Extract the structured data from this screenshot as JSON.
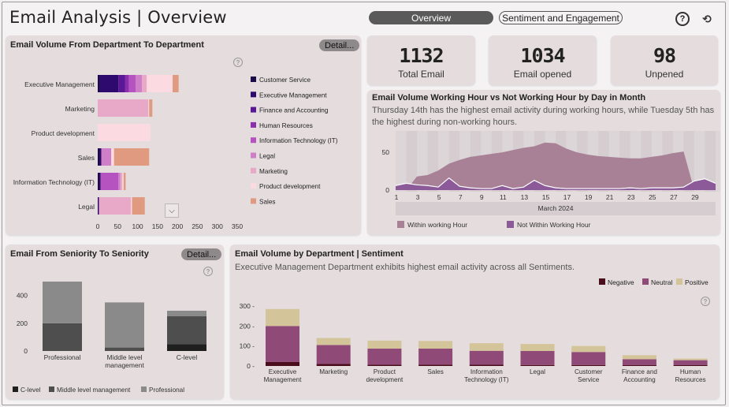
{
  "header": {
    "title": "Email Analysis | Overview",
    "tabs": [
      {
        "label": "Overview",
        "active": true
      },
      {
        "label": "Sentiment and Engagement",
        "active": false
      }
    ],
    "help_icon": "help-icon",
    "reset_icon": "reset-icon"
  },
  "kpis": [
    {
      "value": "1132",
      "label": "Total Email"
    },
    {
      "value": "1034",
      "label": "Email opened"
    },
    {
      "value": "98",
      "label": "Unpened"
    }
  ],
  "dept_card": {
    "title": "Email Volume From Department To Department",
    "detail_label": "Detail..."
  },
  "seniority_card": {
    "title": "Email From Seniority To Seniority",
    "detail_label": "Detail..."
  },
  "hours_card": {
    "title": "Email Volume Working Hour vs Not Working Hour by Day in Month",
    "subtitle": "Thursday 14th has the highest email activity during working hours, while Tuesday 5th has the highest during non-working hours."
  },
  "sentiment_card": {
    "title": "Email Volume by Department | Sentiment",
    "subtitle": "Executive Management Department exhibits highest email activity across all Sentiments."
  },
  "colors": {
    "customer_service": "#1b0b47",
    "executive_management": "#2e0a6e",
    "finance_accounting": "#5a1896",
    "human_resources": "#8c2fad",
    "it": "#b554c0",
    "legal": "#cf7ec8",
    "marketing": "#e8a9c8",
    "product_development": "#fbdbe1",
    "sales": "#df9a80",
    "within": "#a88197",
    "not_within": "#8c5a98",
    "negative": "#4a0d1b",
    "neutral": "#8f4a78",
    "positive": "#d4c49a",
    "c_level": "#1f1f1f",
    "middle": "#4e4e4e",
    "professional": "#8a8a8a"
  },
  "chart_data": [
    {
      "type": "bar",
      "orientation": "horizontal",
      "stacked": true,
      "categories": [
        "Executive Management",
        "Marketing",
        "Product development",
        "Sales",
        "Information Technology (IT)",
        "Legal"
      ],
      "xlim": [
        0,
        350
      ],
      "x_ticks": [
        "0",
        "50",
        "100",
        "150",
        "200",
        "250",
        "300",
        "350"
      ],
      "series": [
        {
          "name": "Customer Service",
          "values": [
            5,
            0,
            0,
            5,
            5,
            0
          ]
        },
        {
          "name": "Executive Management",
          "values": [
            47,
            0,
            0,
            4,
            2,
            3
          ]
        },
        {
          "name": "Finance and Accounting",
          "values": [
            17,
            0,
            0,
            0,
            0,
            0
          ]
        },
        {
          "name": "Human Resources",
          "values": [
            9,
            0,
            0,
            0,
            0,
            0
          ]
        },
        {
          "name": "Information Technology (IT)",
          "values": [
            17,
            0,
            0,
            0,
            45,
            0
          ]
        },
        {
          "name": "Legal",
          "values": [
            16,
            0,
            0,
            25,
            5,
            0
          ]
        },
        {
          "name": "Marketing",
          "values": [
            12,
            127,
            0,
            0,
            5,
            80
          ]
        },
        {
          "name": "Product development",
          "values": [
            65,
            2,
            132,
            7,
            3,
            3
          ]
        },
        {
          "name": "Sales",
          "values": [
            15,
            8,
            0,
            88,
            5,
            32
          ]
        }
      ],
      "legend_position": "right"
    },
    {
      "type": "area",
      "x": [
        "1",
        "2",
        "3",
        "4",
        "5",
        "6",
        "7",
        "8",
        "9",
        "10",
        "11",
        "12",
        "13",
        "14",
        "15",
        "16",
        "17",
        "18",
        "19",
        "20",
        "21",
        "22",
        "23",
        "24",
        "25",
        "26",
        "27",
        "28",
        "29",
        "30",
        "31"
      ],
      "x_ticks": [
        "1",
        "3",
        "5",
        "7",
        "9",
        "11",
        "13",
        "15",
        "17",
        "19",
        "21",
        "23",
        "25",
        "27",
        "29"
      ],
      "xlabel": "March 2024",
      "y_ticks": [
        "0",
        "50"
      ],
      "series": [
        {
          "name": "Within working Hour",
          "values": [
            0,
            0,
            18,
            20,
            26,
            35,
            40,
            44,
            46,
            48,
            50,
            53,
            56,
            58,
            63,
            62,
            55,
            50,
            47,
            45,
            44,
            43,
            42,
            42,
            44,
            46,
            49,
            51,
            0,
            0,
            0
          ]
        },
        {
          "name": "Not Within Working Hour",
          "values": [
            6,
            9,
            7,
            6,
            4,
            16,
            5,
            3,
            2,
            2,
            6,
            2,
            4,
            13,
            6,
            3,
            2,
            2,
            2,
            2,
            2,
            2,
            3,
            2,
            3,
            3,
            3,
            4,
            12,
            15,
            9
          ]
        }
      ],
      "legend_position": "bottom"
    },
    {
      "type": "bar",
      "stacked": true,
      "categories": [
        "Professional",
        "Middle level management",
        "C-level"
      ],
      "y_ticks": [
        "0",
        "200",
        "400"
      ],
      "series": [
        {
          "name": "C-level",
          "values": [
            0,
            0,
            50
          ]
        },
        {
          "name": "Middle level management",
          "values": [
            200,
            25,
            200
          ]
        },
        {
          "name": "Professional",
          "values": [
            300,
            325,
            40
          ]
        }
      ],
      "legend_position": "bottom"
    },
    {
      "type": "bar",
      "stacked": true,
      "categories": [
        "Executive Management",
        "Marketing",
        "Product development",
        "Sales",
        "Information Technology (IT)",
        "Legal",
        "Customer Service",
        "Finance and Accounting",
        "Human Resources"
      ],
      "y_ticks": [
        "0",
        "100",
        "200",
        "300"
      ],
      "series": [
        {
          "name": "Negative",
          "values": [
            20,
            10,
            7,
            7,
            6,
            5,
            5,
            4,
            4
          ]
        },
        {
          "name": "Neutral",
          "values": [
            180,
            95,
            80,
            80,
            70,
            70,
            65,
            30,
            25
          ]
        },
        {
          "name": "Positive",
          "values": [
            85,
            35,
            40,
            38,
            38,
            35,
            30,
            20,
            8
          ]
        }
      ],
      "legend_position": "top-right"
    }
  ]
}
